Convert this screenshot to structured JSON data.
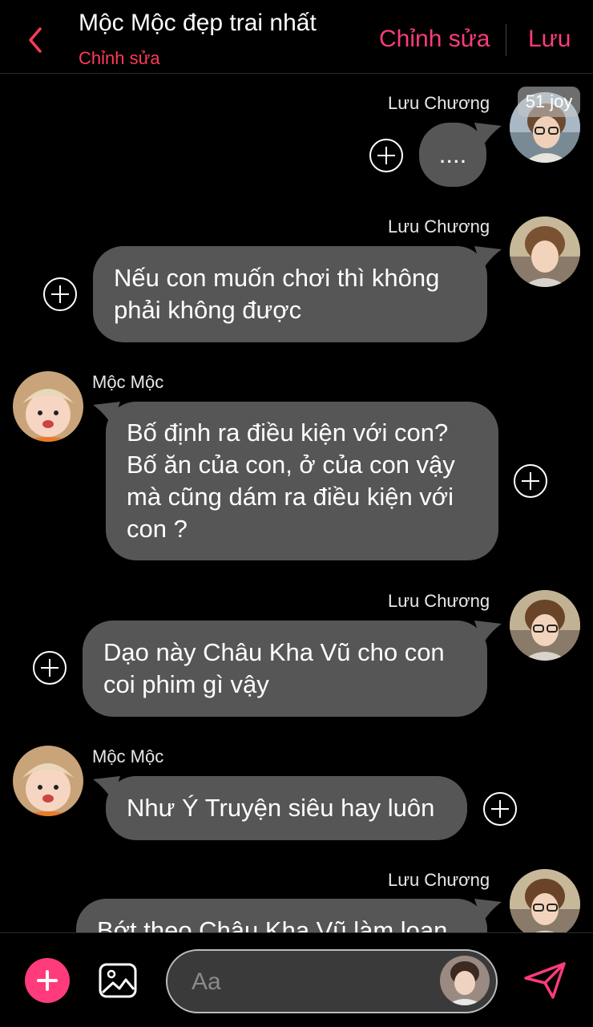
{
  "header": {
    "title": "Mộc Mộc đẹp trai nhất",
    "subtitle": "Chỉnh sửa",
    "edit_label": "Chỉnh sửa",
    "save_label": "Lưu"
  },
  "messages": [
    {
      "sender": "Lưu Chương",
      "text_lines": [
        "...."
      ],
      "badge": "51 joy"
    },
    {
      "sender": "Lưu Chương",
      "text_lines": [
        "Nếu con muốn chơi thì không",
        "phải không được"
      ]
    },
    {
      "sender": "Mộc Mộc",
      "text_lines": [
        "Bố định ra điều kiện với con?",
        "Bố ăn của con, ở của con vậy",
        "mà cũng dám ra điều kiện với",
        "con ?"
      ]
    },
    {
      "sender": "Lưu Chương",
      "text_lines": [
        "Dạo này Châu Kha Vũ cho con",
        "coi phim gì vậy"
      ]
    },
    {
      "sender": "Mộc Mộc",
      "text_lines": [
        "Như Ý Truyện siêu hay luôn"
      ]
    },
    {
      "sender": "Lưu Chương",
      "text_lines": [
        "Bớt theo Châu Kha Vũ làm loạn"
      ]
    }
  ],
  "composer": {
    "placeholder": "Aa"
  },
  "icons": {
    "back": "chevron-left-icon",
    "add": "plus-icon",
    "image": "image-icon",
    "send": "send-icon",
    "add_reaction": "add-circle-icon"
  },
  "colors": {
    "accent": "#ff3b7c",
    "bubble": "#565656",
    "background": "#000000"
  }
}
